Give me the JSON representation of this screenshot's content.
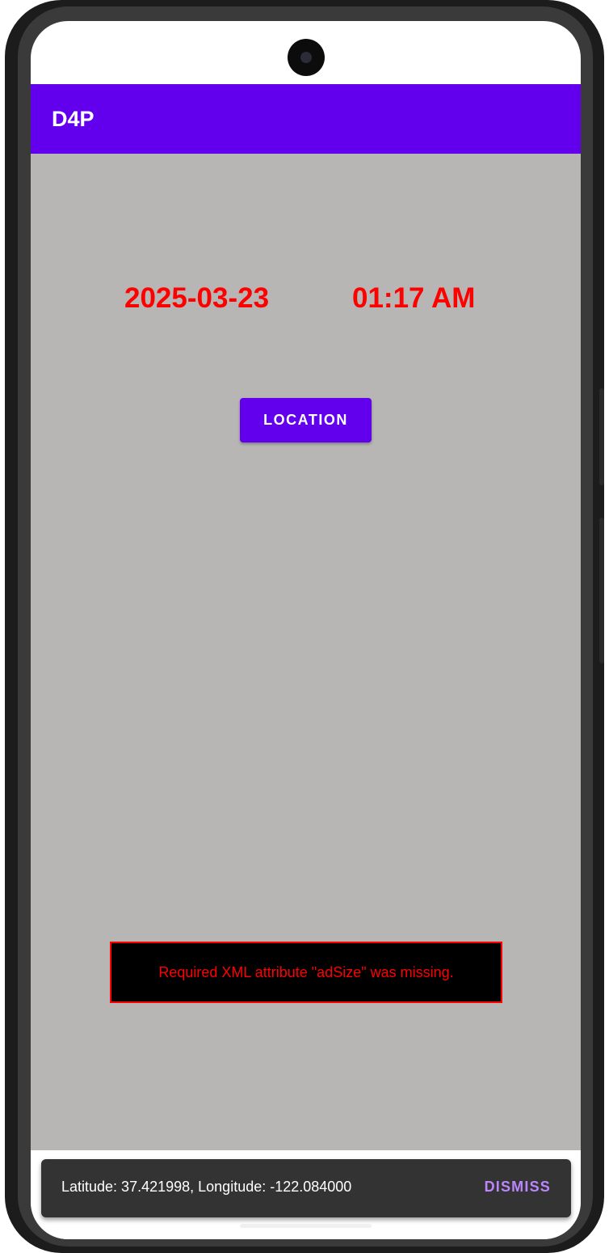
{
  "app_bar": {
    "title": "D4P"
  },
  "main": {
    "date": "2025-03-23",
    "time": "01:17 AM",
    "location_button": "LOCATION",
    "ad_error": "Required XML attribute \"adSize\" was missing."
  },
  "bottom_nav": {
    "items": [
      {
        "icon": "list-icon"
      },
      {
        "icon": "pin-icon"
      },
      {
        "icon": "media-icon"
      },
      {
        "icon": "clock-icon",
        "selected": true
      }
    ],
    "accent": "#6200ee"
  },
  "snackbar": {
    "message": "Latitude: 37.421998, Longitude: -122.084000",
    "action": "DISMISS"
  },
  "colors": {
    "primary": "#6200ee",
    "background": "#b7b6b5",
    "date_time": "#ff0000",
    "snackbar_action": "#bb86fc"
  }
}
